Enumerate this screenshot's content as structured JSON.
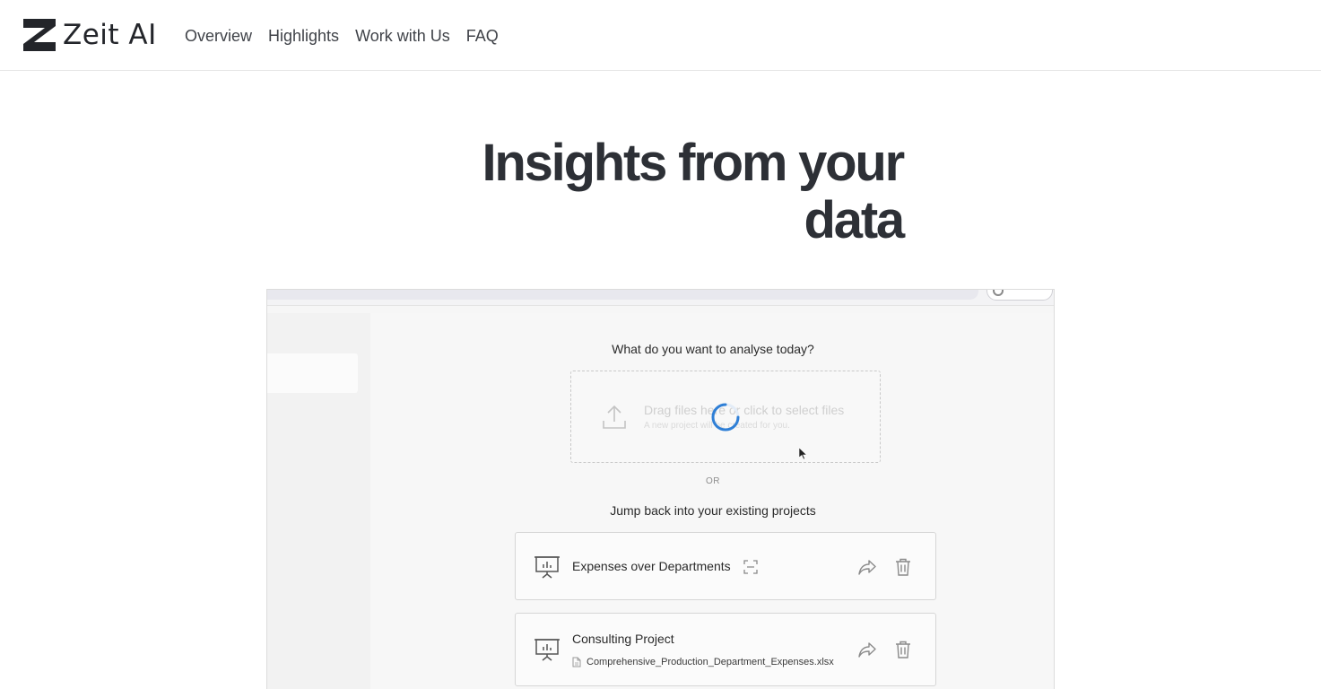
{
  "header": {
    "logo_text": "Zeit AI",
    "nav": [
      "Overview",
      "Highlights",
      "Work with Us",
      "FAQ"
    ]
  },
  "hero": {
    "title_line1": "Insights from your",
    "title_line2": "data"
  },
  "app": {
    "prompt": "What do you want to analyse today?",
    "dropzone": {
      "title": "Drag files here or click to select files",
      "subtitle": "A new project will be created for you."
    },
    "or_label": "OR",
    "projects_title": "Jump back into your existing projects",
    "projects": [
      {
        "name": "Expenses over Departments",
        "file": ""
      },
      {
        "name": "Consulting Project",
        "file": "Comprehensive_Production_Department_Expenses.xlsx"
      }
    ]
  },
  "colors": {
    "text": "#2d3036",
    "spinner": "#2f7fd6",
    "border": "#e6e6e6"
  },
  "icons": [
    "zeit-logo-icon",
    "upload-icon",
    "spinner-icon",
    "cursor-icon",
    "presentation-chart-icon",
    "fullscreen-icon",
    "share-icon",
    "trash-icon",
    "file-icon",
    "user-icon"
  ]
}
